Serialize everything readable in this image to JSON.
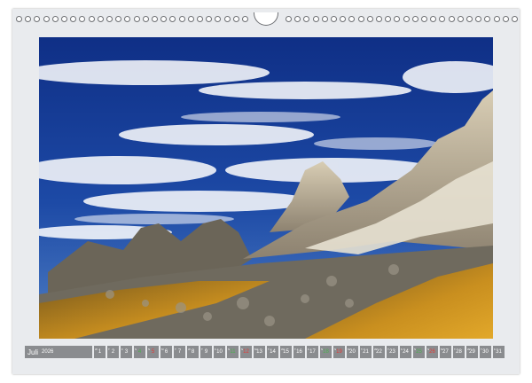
{
  "calendar": {
    "month": "Juli",
    "year": "2026",
    "days": [
      {
        "num": "1",
        "wd": "W"
      },
      {
        "num": "2",
        "wd": "T"
      },
      {
        "num": "3",
        "wd": "F"
      },
      {
        "num": "4",
        "wd": "S"
      },
      {
        "num": "5",
        "wd": "S"
      },
      {
        "num": "6",
        "wd": "M"
      },
      {
        "num": "7",
        "wd": "T"
      },
      {
        "num": "8",
        "wd": "W"
      },
      {
        "num": "9",
        "wd": "T"
      },
      {
        "num": "10",
        "wd": "F"
      },
      {
        "num": "11",
        "wd": "S"
      },
      {
        "num": "12",
        "wd": "S"
      },
      {
        "num": "13",
        "wd": "M"
      },
      {
        "num": "14",
        "wd": "T"
      },
      {
        "num": "15",
        "wd": "W"
      },
      {
        "num": "16",
        "wd": "T"
      },
      {
        "num": "17",
        "wd": "F"
      },
      {
        "num": "18",
        "wd": "S"
      },
      {
        "num": "19",
        "wd": "S"
      },
      {
        "num": "20",
        "wd": "M"
      },
      {
        "num": "21",
        "wd": "T"
      },
      {
        "num": "22",
        "wd": "W"
      },
      {
        "num": "23",
        "wd": "T"
      },
      {
        "num": "24",
        "wd": "F"
      },
      {
        "num": "25",
        "wd": "S"
      },
      {
        "num": "26",
        "wd": "S"
      },
      {
        "num": "27",
        "wd": "M"
      },
      {
        "num": "28",
        "wd": "T"
      },
      {
        "num": "29",
        "wd": "W"
      },
      {
        "num": "30",
        "wd": "T"
      },
      {
        "num": "31",
        "wd": "F"
      }
    ]
  },
  "colors": {
    "page": "#e9ebee",
    "date_bar": "#8a8c8f",
    "weekend_text": "#4caf50",
    "sunday_text": "#e53935"
  }
}
